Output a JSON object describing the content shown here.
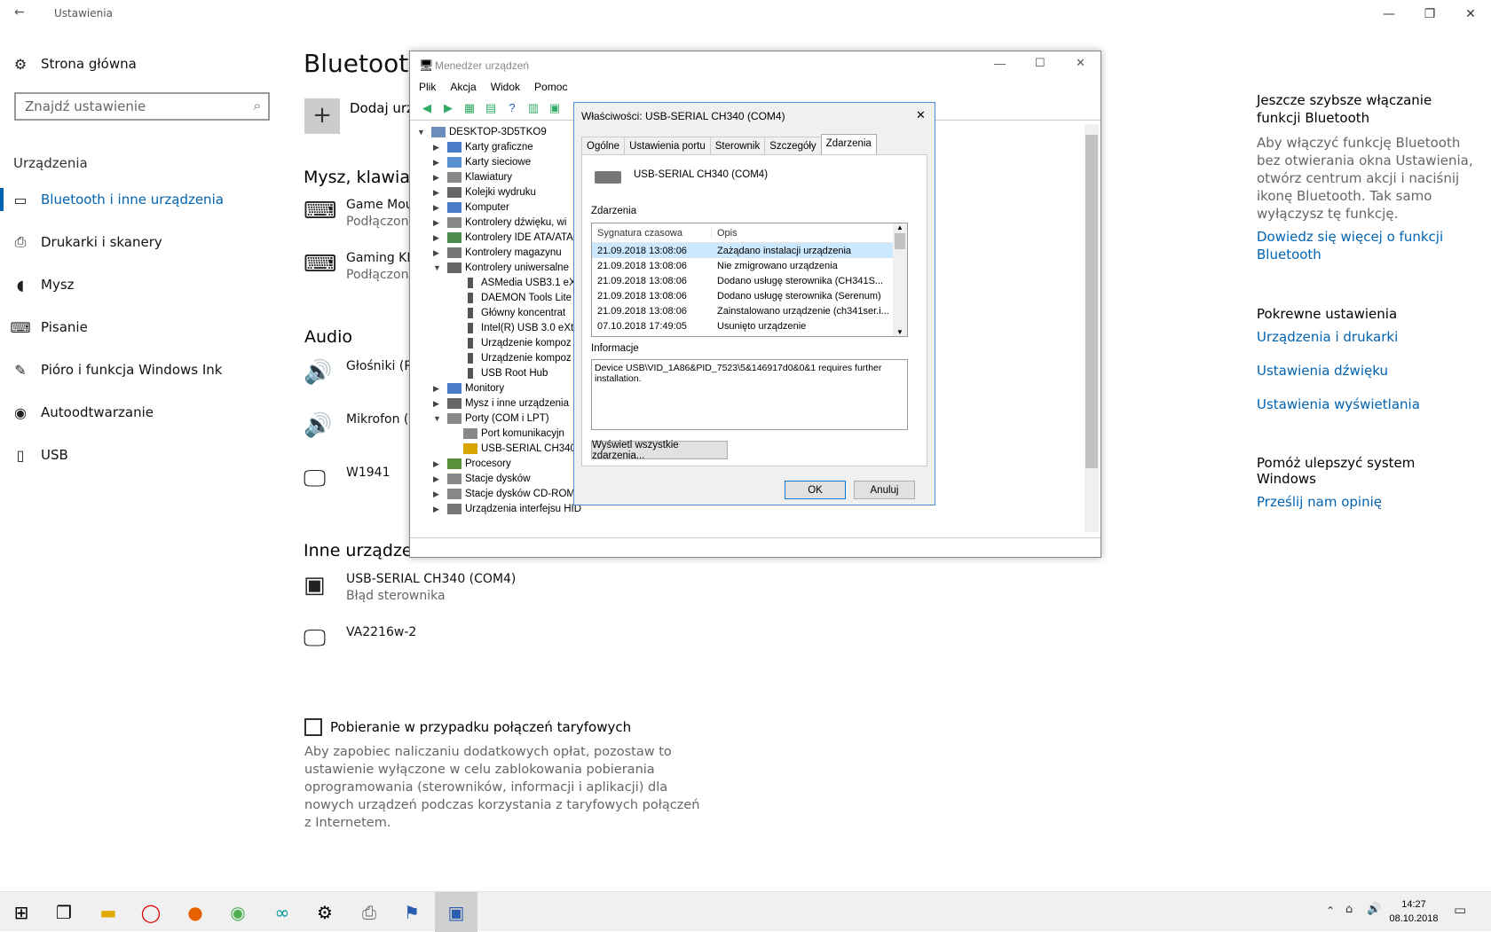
{
  "window": {
    "title": "Ustawienia"
  },
  "nav": {
    "home": "Strona główna",
    "search_placeholder": "Znajdź ustawienie",
    "section": "Urządzenia",
    "items": [
      "Bluetooth i inne urządzenia",
      "Drukarki i skanery",
      "Mysz",
      "Pisanie",
      "Pióro i funkcja Windows Ink",
      "Autoodtwarzanie",
      "USB"
    ]
  },
  "main": {
    "title": "Bluetooth",
    "add_label": "Dodaj urz",
    "section_mouse": "Mysz, klawiat",
    "mouse_devices": [
      {
        "name": "Game Mou",
        "status": "Podłączono"
      },
      {
        "name": "Gaming KB",
        "status": "Podłączono"
      }
    ],
    "section_audio": "Audio",
    "audio_devices": [
      {
        "name": "Głośniki (R"
      },
      {
        "name": "Mikrofon ("
      },
      {
        "name": "W1941"
      }
    ],
    "section_other": "Inne urządzenia",
    "other_devices": [
      {
        "name": "USB-SERIAL CH340 (COM4)",
        "status": "Błąd sterownika"
      },
      {
        "name": "VA2216w-2",
        "status": ""
      }
    ],
    "metered_label": "Pobieranie w przypadku połączeń taryfowych",
    "metered_desc": "Aby zapobiec naliczaniu dodatkowych opłat, pozostaw to ustawienie wyłączone w celu zablokowania pobierania oprogramowania (sterowników, informacji i aplikacji) dla nowych urządzeń podczas korzystania z taryfowych połączeń z Internetem."
  },
  "right": {
    "h1": "Jeszcze szybsze włączanie funkcji Bluetooth",
    "p1": "Aby włączyć funkcję Bluetooth bez otwierania okna Ustawienia, otwórz centrum akcji i naciśnij ikonę Bluetooth. Tak samo wyłączysz tę funkcję.",
    "link1": "Dowiedz się więcej o funkcji Bluetooth",
    "h2": "Pokrewne ustawienia",
    "link2": "Urządzenia i drukarki",
    "link3": "Ustawienia dźwięku",
    "link4": "Ustawienia wyświetlania",
    "h3": "Pomóż ulepszyć system Windows",
    "link5": "Prześlij nam opinię"
  },
  "dm": {
    "title": "Menedżer urządzeń",
    "menu": [
      "Plik",
      "Akcja",
      "Widok",
      "Pomoc"
    ],
    "root": "DESKTOP-3D5TKO9",
    "nodes": [
      "Karty graficzne",
      "Karty sieciowe",
      "Klawiatury",
      "Kolejki wydruku",
      "Komputer",
      "Kontrolery dźwięku, wi",
      "Kontrolery IDE ATA/ATA",
      "Kontrolery magazynu",
      "Kontrolery uniwersalne",
      "ASMedia USB3.1 eX",
      "DAEMON Tools Lite",
      "Główny koncentrat",
      "Intel(R) USB 3.0 eXt",
      "Urządzenie kompoz",
      "Urządzenie kompoz",
      "USB Root Hub",
      "Monitory",
      "Mysz i inne urządzenia",
      "Porty (COM i LPT)",
      "Port komunikacyjn",
      "USB-SERIAL CH340",
      "Procesory",
      "Stacje dysków",
      "Stacje dysków CD-ROM/DVD",
      "Urządzenia interfejsu HID"
    ]
  },
  "props": {
    "title": "Właściwości: USB-SERIAL CH340 (COM4)",
    "tabs": [
      "Ogólne",
      "Ustawienia portu",
      "Sterownik",
      "Szczegóły",
      "Zdarzenia"
    ],
    "device": "USB-SERIAL CH340 (COM4)",
    "events_label": "Zdarzenia",
    "col1": "Sygnatura czasowa",
    "col2": "Opis",
    "rows": [
      [
        "21.09.2018 13:08:06",
        "Zażądano instalacji urządzenia"
      ],
      [
        "21.09.2018 13:08:06",
        "Nie zmigrowano urządzenia"
      ],
      [
        "21.09.2018 13:08:06",
        "Dodano usługę sterownika (CH341S..."
      ],
      [
        "21.09.2018 13:08:06",
        "Dodano usługę sterownika (Serenum)"
      ],
      [
        "21.09.2018 13:08:06",
        "Zainstalowano urządzenie (ch341ser.i..."
      ],
      [
        "07.10.2018 17:49:05",
        "Usunięto urządzenie"
      ]
    ],
    "info_label": "Informacje",
    "info_text": "Device USB\\VID_1A86&PID_7523\\5&146917d0&0&1 requires further installation.",
    "show_all": "Wyświetl wszystkie zdarzenia...",
    "ok": "OK",
    "cancel": "Anuluj"
  },
  "tray": {
    "time": "14:27",
    "date": "08.10.2018"
  }
}
